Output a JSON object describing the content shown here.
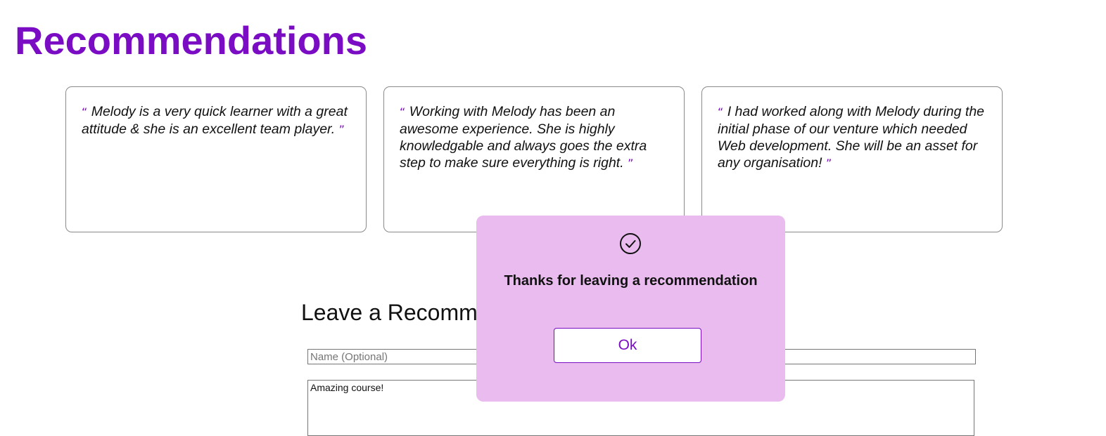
{
  "page": {
    "title": "Recommendations"
  },
  "recommendations": [
    {
      "open_quote": "“",
      "text": "Melody is a very quick learner with a great attitude & she is an excellent team player.",
      "close_quote": "”"
    },
    {
      "open_quote": "“",
      "text": "Working with Melody has been an awesome experience. She is highly knowledgable and always goes the extra step to make sure everything is right.",
      "close_quote": "”"
    },
    {
      "open_quote": "“",
      "text": "I had worked along with Melody during the initial phase of our venture which needed Web development. She will be an asset for any organisation!",
      "close_quote": "”"
    }
  ],
  "form": {
    "title": "Leave a Recommendation",
    "name_placeholder": "Name (Optional)",
    "name_value": "",
    "message_value": "Amazing course!"
  },
  "modal": {
    "icon": "check-circle-icon",
    "message": "Thanks for leaving a recommendation",
    "ok_label": "Ok"
  },
  "colors": {
    "accent": "#7a0dc4",
    "modal_background": "#e9bbee"
  }
}
